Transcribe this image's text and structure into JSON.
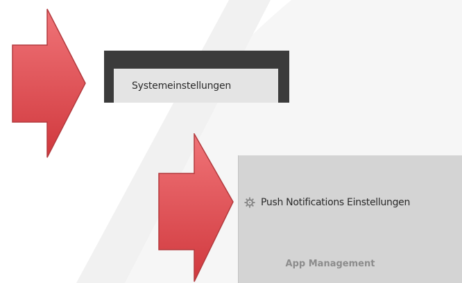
{
  "menu": {
    "system_settings_label": "Systemeinstellungen"
  },
  "ribbon": {
    "push_notifications_label": "Push Notifications Einstellungen",
    "push_notifications_icon": "gear-icon",
    "group_label": "App Management"
  },
  "annotations": {
    "arrow_color": "#e8585c",
    "arrow_count": 2
  }
}
